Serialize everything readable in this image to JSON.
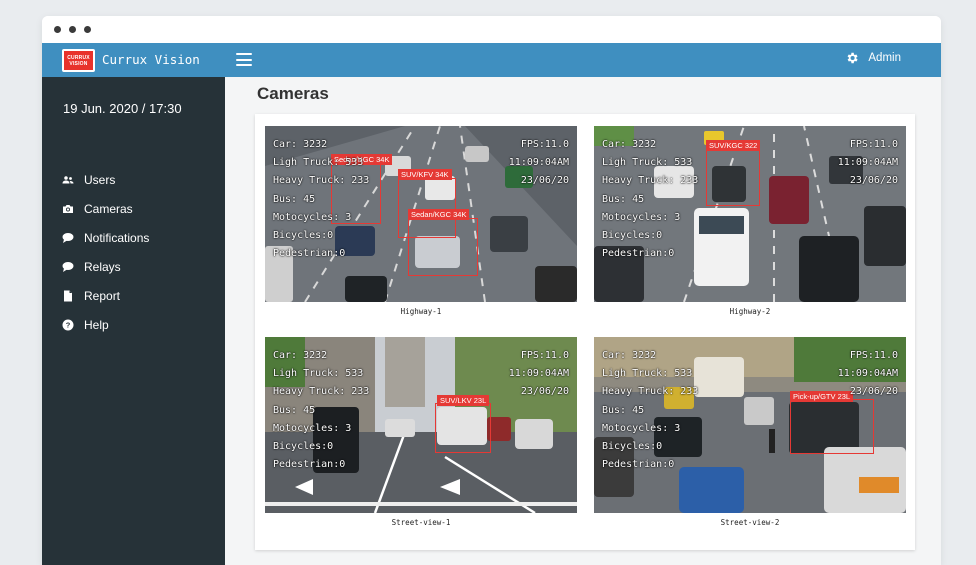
{
  "app": {
    "brand": "Currux Vision",
    "logo_text": "CURRUX VISION",
    "accent": "#3f8fc0",
    "sidebar_bg": "#263238",
    "detection_color": "#e53935"
  },
  "header": {
    "menu_icon": "hamburger-icon",
    "user_icon": "gear-icon",
    "user_label": "Admin"
  },
  "sidebar": {
    "datetime": "19 Jun. 2020 / 17:30",
    "items": [
      {
        "label": "Users",
        "icon": "users-icon"
      },
      {
        "label": "Cameras",
        "icon": "camera-icon"
      },
      {
        "label": "Notifications",
        "icon": "chat-bubble-icon"
      },
      {
        "label": "Relays",
        "icon": "chat-bubble-icon"
      },
      {
        "label": "Report",
        "icon": "document-icon"
      },
      {
        "label": "Help",
        "icon": "question-circle-icon"
      }
    ]
  },
  "main": {
    "title": "Cameras",
    "cameras": [
      {
        "name": "Highway-1",
        "stats": [
          "Car: 3232",
          "Ligh Truck: 533",
          "Heavy Truck: 233",
          "Bus: 45",
          "Motocycles: 3",
          "Bicycles:0",
          "Pedestrian:0"
        ],
        "meta": [
          "FPS:11.0",
          "11:09:04AM",
          "23/06/20"
        ],
        "detections": [
          "Sedan/KGC 34K",
          "SUV/KFV 34K",
          "Sedan/KGC 34K"
        ]
      },
      {
        "name": "Highway-2",
        "stats": [
          "Car: 3232",
          "Ligh Truck: 533",
          "Heavy Truck: 233",
          "Bus: 45",
          "Motocycles: 3",
          "Bicycles:0",
          "Pedestrian:0"
        ],
        "meta": [
          "FPS:11.0",
          "11:09:04AM",
          "23/06/20"
        ],
        "detections": [
          "SUV/KGC 322"
        ]
      },
      {
        "name": "Street-view-1",
        "stats": [
          "Car: 3232",
          "Ligh Truck: 533",
          "Heavy Truck: 233",
          "Bus: 45",
          "Motocycles: 3",
          "Bicycles:0",
          "Pedestrian:0"
        ],
        "meta": [
          "FPS:11.0",
          "11:09:04AM",
          "23/06/20"
        ],
        "detections": [
          "SUV/LKV 23L"
        ]
      },
      {
        "name": "Street-view-2",
        "stats": [
          "Car: 3232",
          "Ligh Truck: 533",
          "Heavy Truck: 233",
          "Bus: 45",
          "Motocycles: 3",
          "Bicycles:0",
          "Pedestrian:0"
        ],
        "meta": [
          "FPS:11.0",
          "11:09:04AM",
          "23/06/20"
        ],
        "detections": [
          "Pick-up/GTV 23L"
        ]
      }
    ]
  }
}
